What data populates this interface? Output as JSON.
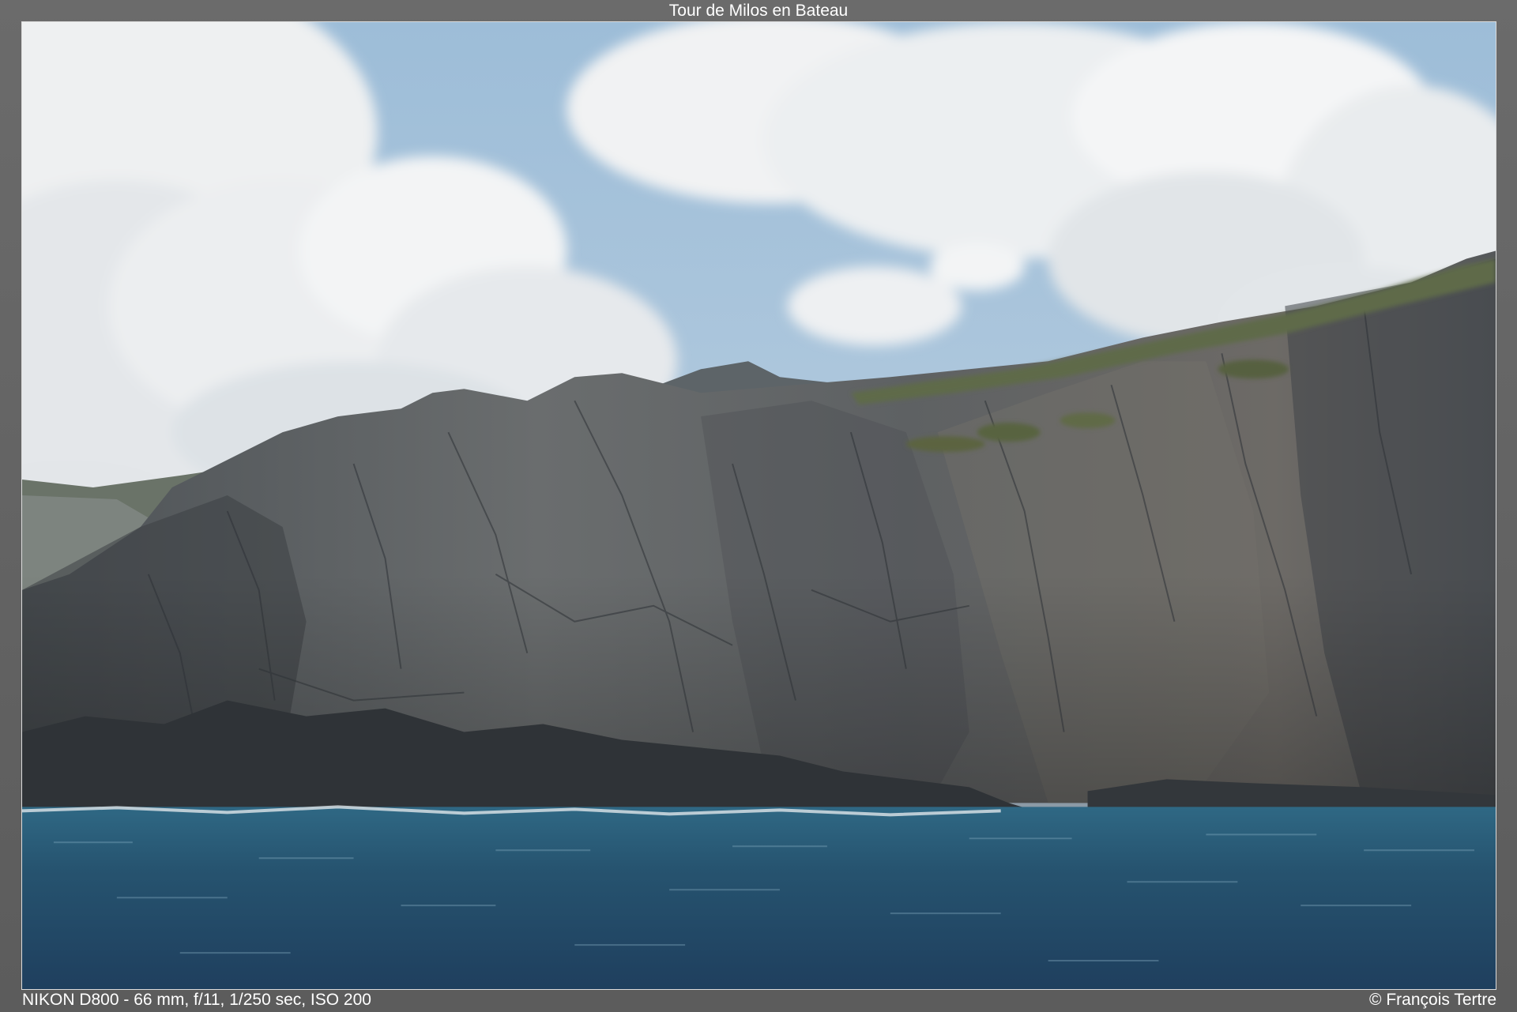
{
  "gallery": {
    "title": "Tour de Milos en Bateau",
    "exif": "NIKON D800 - 66 mm, f/11, 1/250 sec, ISO 200",
    "copyright": "© François Tertre"
  },
  "scene": {
    "subject": "rocky-sea-cliff",
    "colors": {
      "sky": "#a9c6de",
      "cloud": "#f2f3f4",
      "rock": "#5e6266",
      "rock_dark": "#34383c",
      "vegetation": "#5f6a48",
      "sea": "#2a5977",
      "sea_deep": "#1d3e5c"
    }
  }
}
